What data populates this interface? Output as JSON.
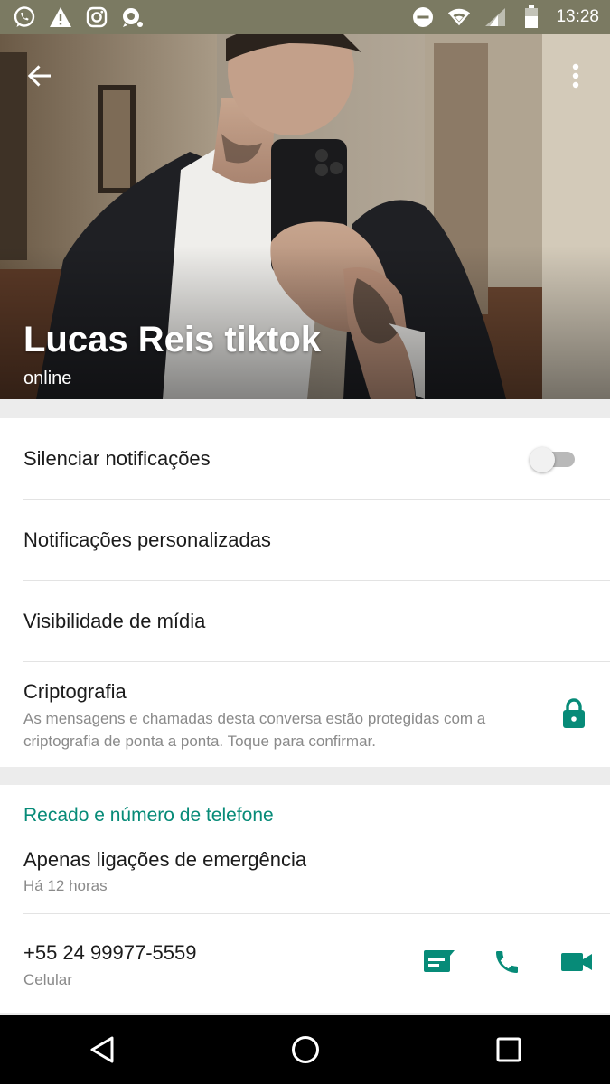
{
  "status_bar": {
    "time": "13:28",
    "left_icons": [
      "whatsapp-icon",
      "warning-icon",
      "instagram-icon",
      "location-alert-icon"
    ],
    "right_icons": [
      "do-not-disturb-icon",
      "wifi-icon",
      "signal-icon",
      "battery-icon"
    ]
  },
  "header": {
    "contact_name": "Lucas Reis tiktok",
    "status": "online"
  },
  "settings": {
    "mute": {
      "label": "Silenciar notificações",
      "enabled": false
    },
    "custom_notifications": {
      "label": "Notificações personalizadas"
    },
    "media_visibility": {
      "label": "Visibilidade de mídia"
    },
    "encryption": {
      "label": "Criptografia",
      "description_line1": "As mensagens e chamadas desta conversa estão protegidas com a",
      "description_line2": "criptografia de ponta a ponta. Toque para confirmar."
    }
  },
  "info": {
    "section_title": "Recado e número de telefone",
    "about_text": "Apenas ligações de emergência",
    "about_time": "Há 12 horas",
    "phone_number": "+55 24 99977-5559",
    "phone_type": "Celular"
  },
  "colors": {
    "accent": "#078b78",
    "status_bar": "#7b7a62",
    "nav_bar": "#000000"
  }
}
